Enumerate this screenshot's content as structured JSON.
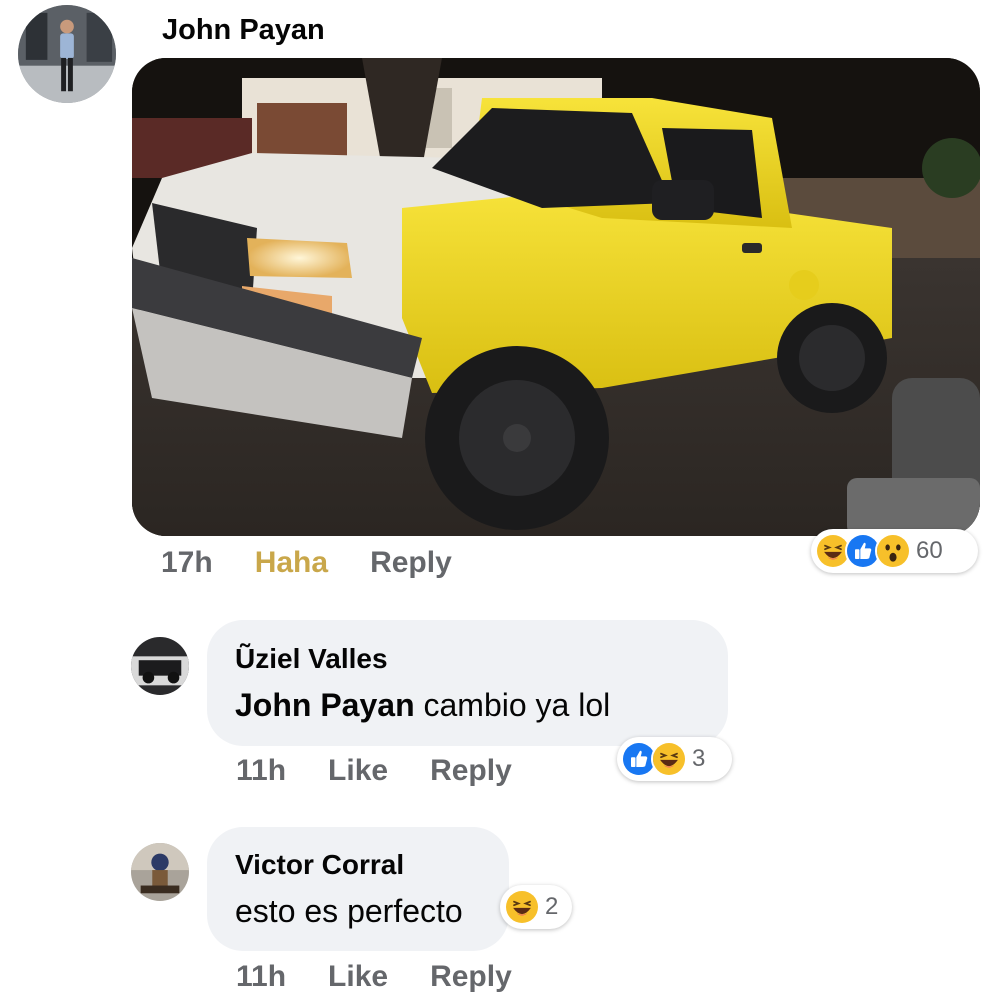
{
  "post": {
    "author": "John Payan",
    "time": "17h",
    "own_reaction": "Haha",
    "reply_label": "Reply",
    "reactions": {
      "icons": [
        "haha-icon",
        "like-icon",
        "wow-icon"
      ],
      "count": "60"
    }
  },
  "replies": [
    {
      "author": "Ũziel Valles",
      "mention": "John Payan",
      "text": "cambio ya lol",
      "time": "11h",
      "like_label": "Like",
      "reply_label": "Reply",
      "reactions": {
        "icons": [
          "like-icon",
          "haha-icon"
        ],
        "count": "3"
      }
    },
    {
      "author": "Victor Corral",
      "text": "esto es perfecto",
      "time": "11h",
      "like_label": "Like",
      "reply_label": "Reply",
      "reactions": {
        "icons": [
          "haha-icon"
        ],
        "count": "2"
      }
    }
  ],
  "colors": {
    "bubble_bg": "#f0f2f5",
    "meta_text": "#65676b",
    "haha_text": "#c9a74a",
    "like_blue": "#1877f2",
    "emoji_yellow": "#f7c02a",
    "truck_yellow": "#f4dc1c"
  }
}
